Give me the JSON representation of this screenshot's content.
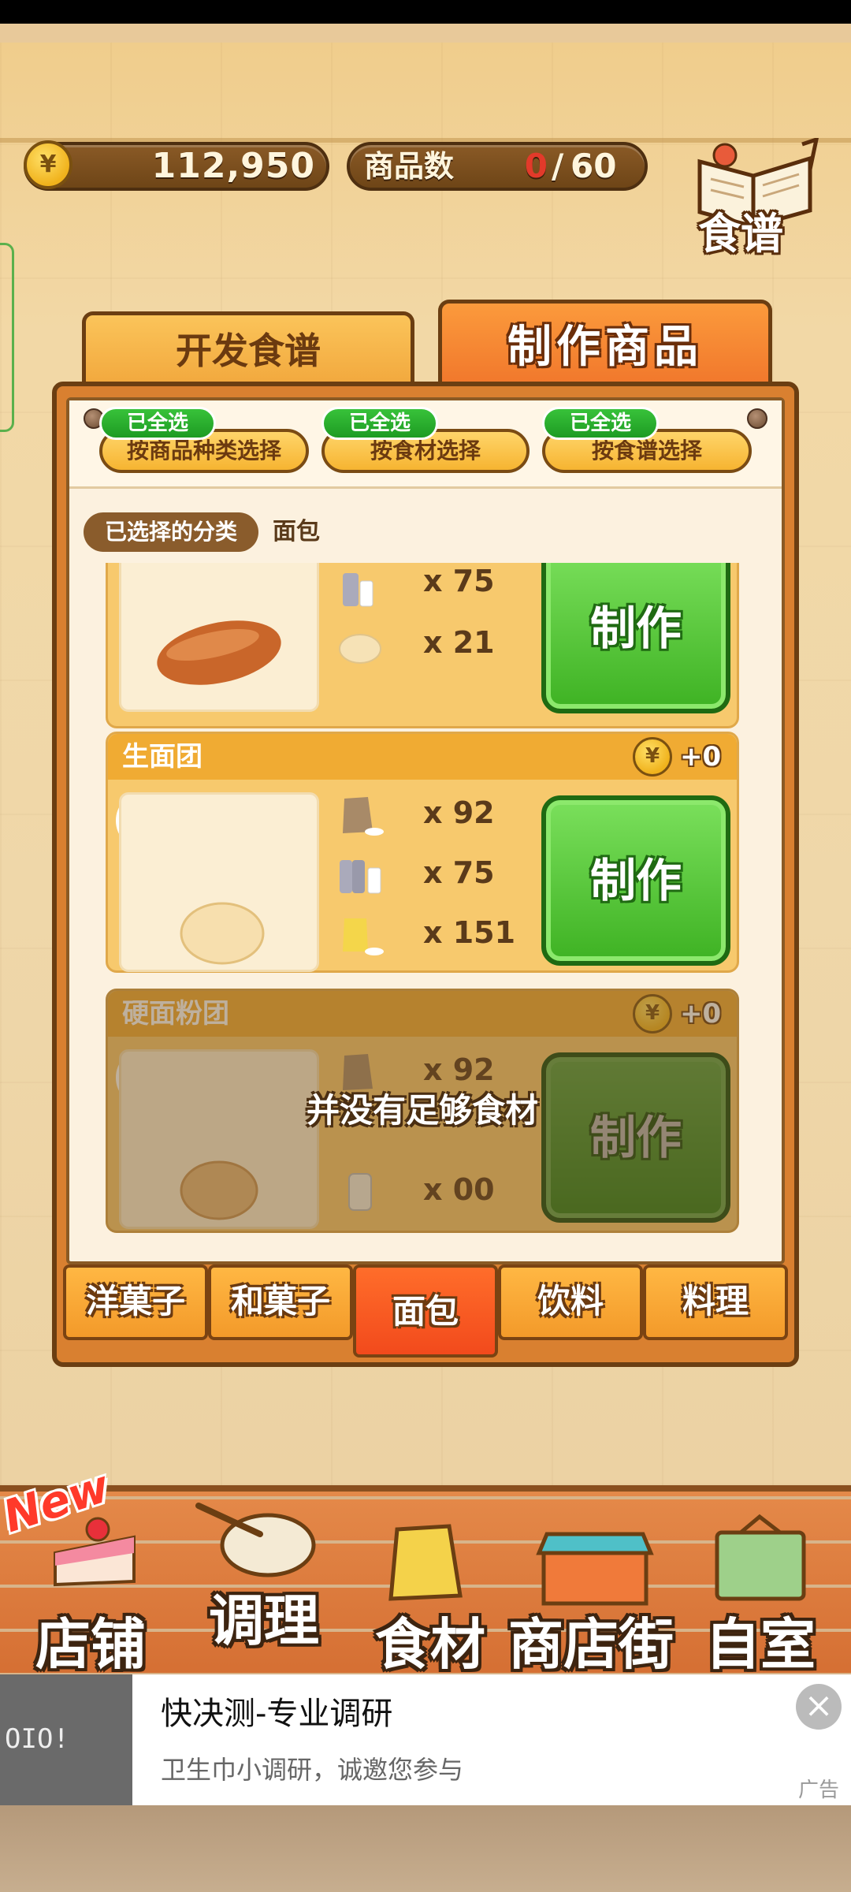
{
  "header": {
    "money": "112,950",
    "currency_symbol": "¥",
    "goods_label": "商品数",
    "goods_count": "0",
    "goods_sep": "/",
    "goods_max": "60",
    "recipe_book_label": "食谱"
  },
  "tabs": {
    "develop": "开发食谱",
    "make": "制作商品"
  },
  "filters": [
    {
      "badge": "已全选",
      "label": "按商品种类选择"
    },
    {
      "badge": "已全选",
      "label": "按食材选择"
    },
    {
      "badge": "已全选",
      "label": "按食谱选择"
    }
  ],
  "selected": {
    "chip": "已选择的分类",
    "value": "面包"
  },
  "products": [
    {
      "name": "",
      "reward": "",
      "ingredients": [
        {
          "icon": "milk-can-icon",
          "qty": "x 75"
        },
        {
          "icon": "dough-icon",
          "qty": "x 21"
        }
      ],
      "make_label": "制作"
    },
    {
      "name": "生面团",
      "reward": "+0",
      "ingredients": [
        {
          "icon": "flour-bag-icon",
          "qty": "x 92"
        },
        {
          "icon": "milk-can-icon",
          "qty": "x 75"
        },
        {
          "icon": "sugar-bag-icon",
          "qty": "x 151"
        }
      ],
      "make_label": "制作"
    },
    {
      "name": "硬面粉团",
      "reward": "+0",
      "ingredients": [
        {
          "icon": "flour-bag-icon",
          "qty": "x 92"
        },
        {
          "icon": "jar-icon",
          "qty": "x 00"
        }
      ],
      "make_label": "制作",
      "disabled_message": "并没有足够食材"
    }
  ],
  "categories": [
    "洋菓子",
    "和菓子",
    "面包",
    "饮料",
    "料理"
  ],
  "active_category": "面包",
  "bottom_nav": {
    "new_tag": "New",
    "items": [
      "店铺",
      "调理",
      "食材",
      "商店街",
      "自室"
    ]
  },
  "ad": {
    "title": "快决测-专业调研",
    "subtitle": "卫生巾小调研，诚邀您参与",
    "tag": "广告",
    "close": "×",
    "thumb_text": "OIO!"
  },
  "colors": {
    "accent_orange": "#f0742a",
    "make_green": "#3eb223",
    "coin_gold": "#f0b21c",
    "badge_green": "#1d9b22"
  }
}
